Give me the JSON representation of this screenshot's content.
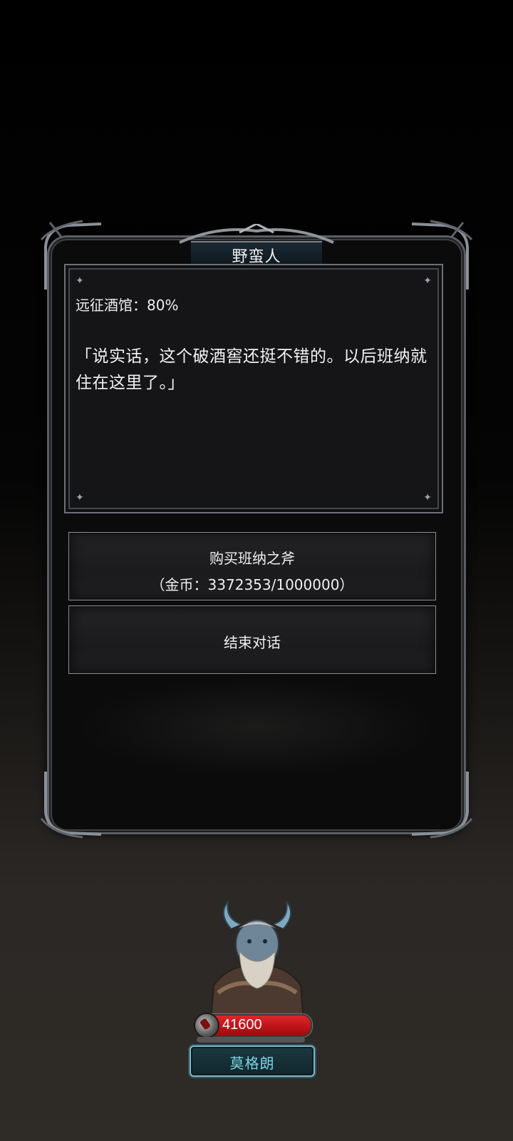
{
  "dialog": {
    "title": "野蛮人",
    "affinity_text": "远征酒馆：80%",
    "speech_text": "「说实话，这个破酒窖还挺不错的。以后班纳就住在这里了。」"
  },
  "options": {
    "buy_label": "购买班纳之斧",
    "buy_cost": "（金币：3372353/1000000）",
    "end_label": "结束对话"
  },
  "hero": {
    "power": "41600",
    "name": "莫格朗",
    "power_bar_color": "#d41a20",
    "name_color": "#7cd4e4"
  }
}
